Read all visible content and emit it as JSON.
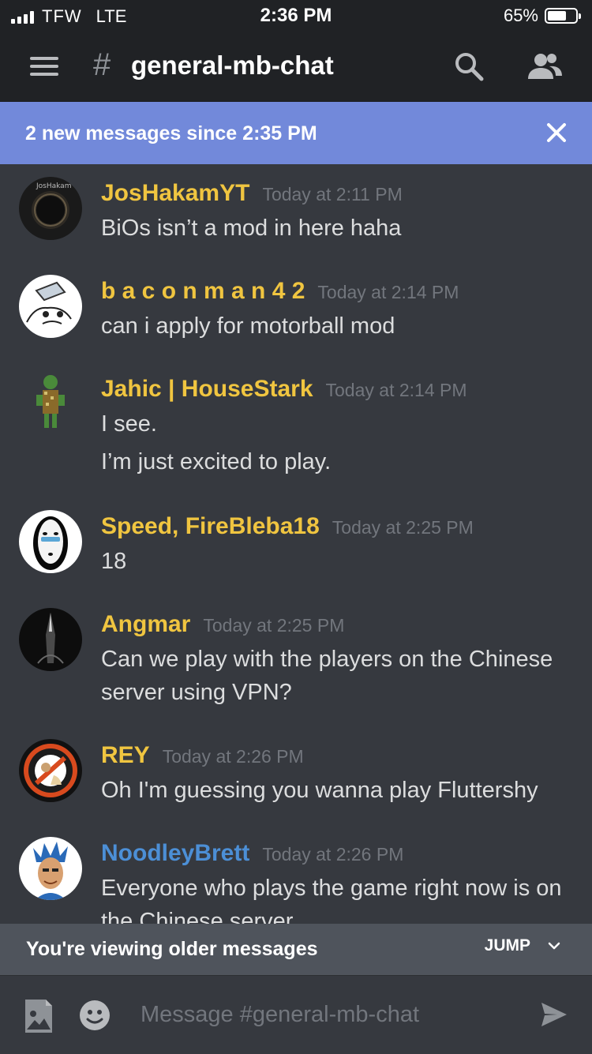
{
  "status_bar": {
    "carrier": "TFW",
    "network": "LTE",
    "time": "2:36 PM",
    "battery": "65%"
  },
  "header": {
    "hash": "#",
    "channel": "general-mb-chat"
  },
  "new_messages_bar": {
    "text": "2 new messages since 2:35 PM"
  },
  "messages": [
    {
      "user": "JosHakamYT",
      "time": "Today at 2:11 PM",
      "lines": [
        "BiOs isn’t a mod in here haha"
      ],
      "avatar_label": "JosHakam"
    },
    {
      "user": "b a c o n m a n 4 2",
      "time": "Today at 2:14 PM",
      "lines": [
        "can i apply for motorball mod"
      ]
    },
    {
      "user": "Jahic | HouseStark",
      "time": "Today at 2:14 PM",
      "lines": [
        "I see.",
        "I’m just excited to play."
      ]
    },
    {
      "user": "Speed, FireBleba18",
      "time": "Today at 2:25 PM",
      "lines": [
        "18"
      ]
    },
    {
      "user": "Angmar",
      "time": "Today at 2:25 PM",
      "lines": [
        "Can we play with the players on the Chinese",
        "server using VPN?"
      ]
    },
    {
      "user": "REY",
      "time": "Today at 2:26 PM",
      "lines": [
        "Oh I'm guessing you wanna play Fluttershy"
      ]
    },
    {
      "user": "NoodleyBrett",
      "time": "Today at 2:26 PM",
      "lines": [
        "Everyone who plays the game right now is on",
        "the Chinese server"
      ]
    }
  ],
  "older_bar": {
    "text": "You're viewing older messages",
    "jump_label": "JUMP"
  },
  "composer": {
    "placeholder": "Message #general-mb-chat"
  },
  "colors": {
    "username": "#f0c540",
    "username_alt": "#4c8fd6",
    "accent": "#7289da",
    "background": "#36393f"
  }
}
